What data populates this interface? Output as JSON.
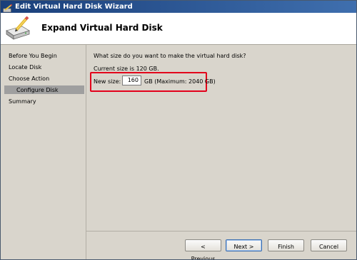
{
  "window": {
    "title": "Edit Virtual Hard Disk Wizard",
    "title_icon": "wizard-icon"
  },
  "header": {
    "title": "Expand Virtual Hard Disk",
    "icon": "hard-disk-pencil-icon"
  },
  "nav": {
    "items": [
      {
        "label": "Before You Begin",
        "selected": false
      },
      {
        "label": "Locate Disk",
        "selected": false
      },
      {
        "label": "Choose Action",
        "selected": false
      },
      {
        "label": "Configure Disk",
        "selected": true
      },
      {
        "label": "Summary",
        "selected": false
      }
    ]
  },
  "content": {
    "question": "What size do you want to make the virtual hard disk?",
    "current_size": "Current size is 120 GB.",
    "new_size_label": "New size:",
    "new_size_value": "160",
    "unit_max": "GB (Maximum: 2040 GB)"
  },
  "buttons": {
    "previous": "< Previous",
    "next": "Next >",
    "finish": "Finish",
    "cancel": "Cancel"
  },
  "colors": {
    "highlight": "#e3001b",
    "titlebar": "#1a3f7a",
    "nav_selected": "#9f9f9f"
  }
}
